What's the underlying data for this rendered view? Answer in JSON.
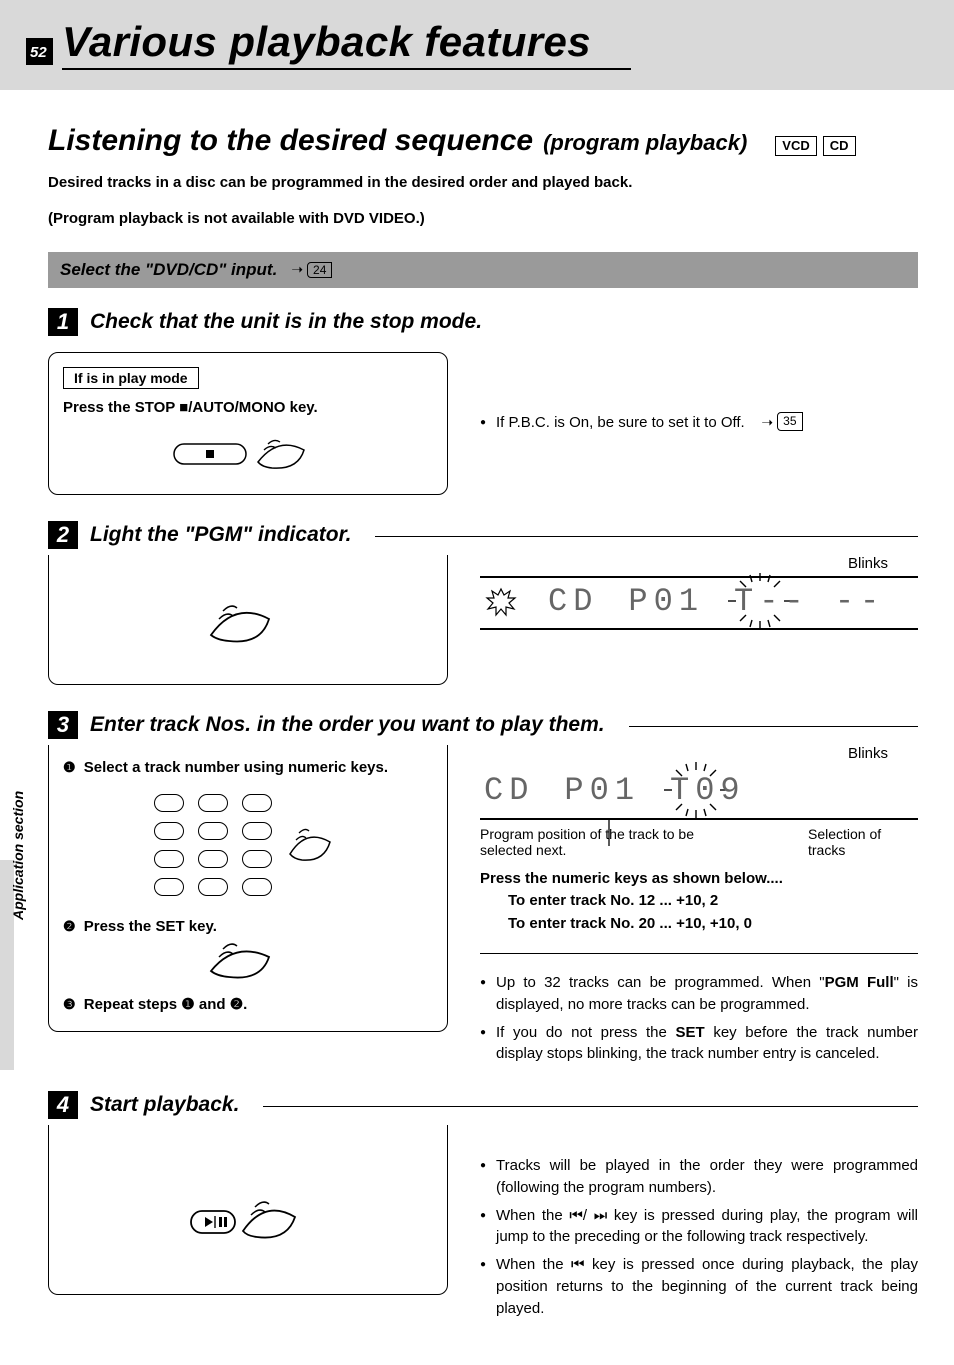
{
  "page_number": "52",
  "chapter_title": "Various playback features",
  "section_title": "Listening to the desired sequence",
  "section_subtitle": "(program playback)",
  "badges": {
    "vcd": "VCD",
    "cd": "CD"
  },
  "intro_line1": "Desired tracks in a disc can be programmed in the desired order and played back.",
  "intro_line2": "(Program playback is not available with DVD VIDEO.)",
  "gray_bar_text": "Select the \"DVD/CD\" input.",
  "page_ref_24": "24",
  "page_ref_35": "35",
  "step1": {
    "num": "1",
    "title": "Check that the unit is in the stop mode.",
    "box_label": "If is in play mode",
    "instruction": "Press the STOP ■/AUTO/MONO key.",
    "right_bullet": "If P.B.C. is On, be sure to set it to Off."
  },
  "step2": {
    "num": "2",
    "title": "Light the \"PGM\" indicator.",
    "blinks": "Blinks",
    "lcd_cd": "CD",
    "lcd_p01": "P01",
    "lcd_t": "T-- --"
  },
  "step3": {
    "num": "3",
    "title": "Enter track Nos. in the order you want to play them.",
    "line1_num": "❶",
    "line1": "Select a track number using numeric keys.",
    "line2_num": "❷",
    "line2": "Press the SET key.",
    "line3_num": "❸",
    "line3": "Repeat steps ❶ and ❷.",
    "blinks": "Blinks",
    "lcd_cd": "CD",
    "lcd_p01": "P01",
    "lcd_t09": "T09",
    "caption_left": "Program position of the track to be selected next.",
    "caption_right": "Selection of tracks",
    "press_header": "Press the numeric keys as shown below....",
    "press_12": "To enter track No. 12  ... +10, 2",
    "press_20": "To enter track No. 20  ... +10, +10, 0",
    "bullet_a1": "Up to 32 tracks can be programmed. When \"",
    "bullet_a_bold": "PGM Full",
    "bullet_a2": "\" is displayed, no more tracks can be programmed.",
    "bullet_b1": "If you do not press the ",
    "bullet_b_bold": "SET",
    "bullet_b2": " key before the track number display stops blinking, the track number entry is canceled."
  },
  "step4": {
    "num": "4",
    "title": "Start playback.",
    "bullet_a": "Tracks will be played in the order they were programmed (following the program numbers).",
    "bullet_b": "When the ⏮/ ⏭ key is pressed during play, the program will jump to the preceding or the following track respectively.",
    "bullet_c": "When the ⏮ key is pressed once during playback, the play position returns to the beginning of the current track being played."
  },
  "side_label": "Application section"
}
